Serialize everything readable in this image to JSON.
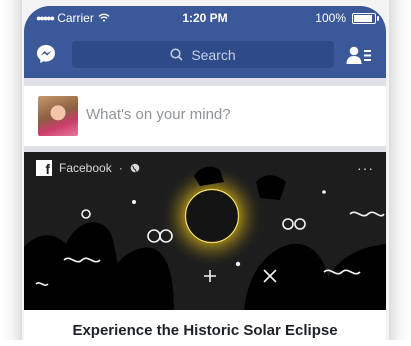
{
  "status_bar": {
    "carrier": "Carrier",
    "time": "1:20 PM",
    "battery": "100%",
    "battery_level": 1.0
  },
  "header": {
    "search_placeholder": "Search",
    "left_icon": "messenger-icon",
    "right_icon": "friend-requests-icon"
  },
  "composer": {
    "placeholder": "What's on your mind?"
  },
  "post": {
    "author": "Facebook",
    "separator": "·",
    "privacy_icon": "globe-icon",
    "more_label": "···",
    "title": "Experience the Historic Solar Eclipse"
  },
  "colors": {
    "brand_blue": "#3b5998",
    "search_bg": "#2e4a89",
    "eclipse_bg": "#1d1d1d",
    "corona": "#f2d024"
  }
}
